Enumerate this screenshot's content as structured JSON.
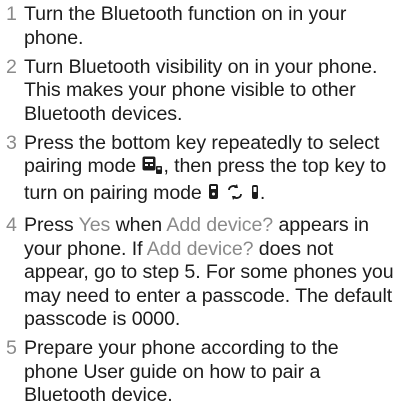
{
  "steps": [
    {
      "number": "1",
      "text": "Turn the Bluetooth function on in your phone."
    },
    {
      "number": "2",
      "text": "Turn Bluetooth visibility on in your phone. This makes your phone visible to other Bluetooth devices."
    },
    {
      "number": "3",
      "text_a": "Press the bottom key repeatedly to select pairing mode",
      "text_b": ", then press the top key to turn on pairing mode",
      "text_c": ".",
      "icons": [
        "pairing-mode-icon",
        "phone-pair-icon",
        "headset-icon"
      ]
    },
    {
      "number": "4",
      "text_a": "Press",
      "yes_label": "Yes",
      "text_b": "when",
      "add_device_label": "Add device?",
      "text_c": "appears in your phone. If",
      "text_d": "does not appear, go to step 5. For some phones you may need to enter a passcode. The default passcode is 0000."
    },
    {
      "number": "5",
      "text": "Prepare your phone according to the phone User guide on how to pair a Bluetooth device."
    }
  ],
  "colors": {
    "text": "#1c1c1c",
    "highlight": "#8a8a8a"
  }
}
